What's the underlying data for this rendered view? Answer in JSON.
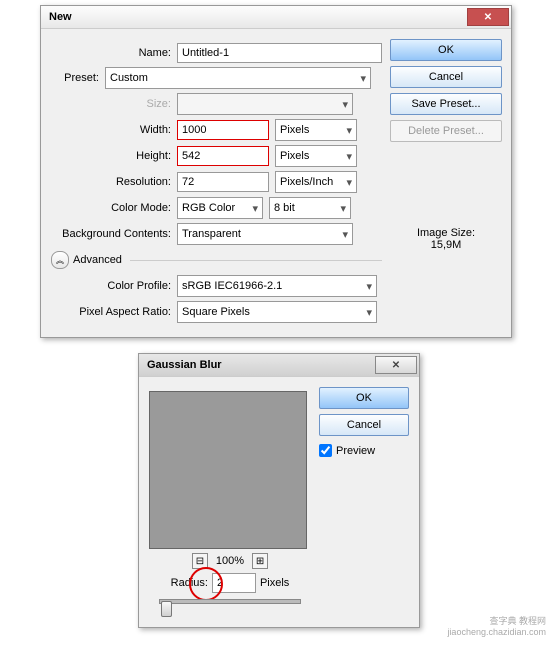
{
  "dialog1": {
    "title": "New",
    "name_label": "Name:",
    "name_value": "Untitled-1",
    "preset_label": "Preset:",
    "preset_value": "Custom",
    "size_label": "Size:",
    "width_label": "Width:",
    "width_value": "1000",
    "width_units": "Pixels",
    "height_label": "Height:",
    "height_value": "542",
    "height_units": "Pixels",
    "resolution_label": "Resolution:",
    "resolution_value": "72",
    "resolution_units": "Pixels/Inch",
    "colormode_label": "Color Mode:",
    "colormode_value": "RGB Color",
    "colormode_depth": "8 bit",
    "bg_label": "Background Contents:",
    "bg_value": "Transparent",
    "advanced_label": "Advanced",
    "profile_label": "Color Profile:",
    "profile_value": "sRGB IEC61966-2.1",
    "aspect_label": "Pixel Aspect Ratio:",
    "aspect_value": "Square Pixels",
    "ok": "OK",
    "cancel": "Cancel",
    "save_preset": "Save Preset...",
    "delete_preset": "Delete Preset...",
    "image_size_label": "Image Size:",
    "image_size_value": "15,9M"
  },
  "dialog2": {
    "title": "Gaussian Blur",
    "ok": "OK",
    "cancel": "Cancel",
    "preview": "Preview",
    "zoom": "100%",
    "zoom_out": "⊟",
    "zoom_in": "⊞",
    "radius_label": "Radius:",
    "radius_value": "2",
    "radius_units": "Pixels"
  },
  "watermark": {
    "line1": "查字典 教程网",
    "line2": "jiaocheng.chazidian.com"
  }
}
